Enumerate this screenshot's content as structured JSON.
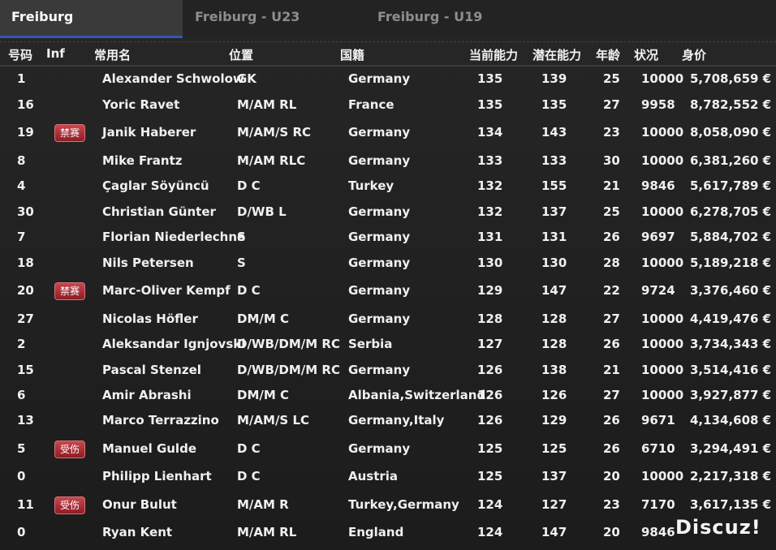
{
  "tabs": [
    "Freiburg",
    "Freiburg - U23",
    "Freiburg - U19"
  ],
  "columns": {
    "num": "号码",
    "inf": "Inf",
    "name": "常用名",
    "position": "位置",
    "nation": "国籍",
    "ca": "当前能力",
    "pa": "潜在能力",
    "age": "年龄",
    "condition": "状况",
    "value": "身价"
  },
  "players": [
    {
      "num": "1",
      "inf": "",
      "name": "Alexander Schwolow",
      "position": "GK",
      "nation": "Germany",
      "ca": "135",
      "pa": "139",
      "age": "25",
      "condition": "10000",
      "value": "5,708,659 €"
    },
    {
      "num": "16",
      "inf": "",
      "name": "Yoric Ravet",
      "position": "M/AM RL",
      "nation": "France",
      "ca": "135",
      "pa": "135",
      "age": "27",
      "condition": "9958",
      "value": "8,782,552 €"
    },
    {
      "num": "19",
      "inf": "禁赛",
      "name": "Janik Haberer",
      "position": "M/AM/S RC",
      "nation": "Germany",
      "ca": "134",
      "pa": "143",
      "age": "23",
      "condition": "10000",
      "value": "8,058,090 €"
    },
    {
      "num": "8",
      "inf": "",
      "name": "Mike Frantz",
      "position": "M/AM RLC",
      "nation": "Germany",
      "ca": "133",
      "pa": "133",
      "age": "30",
      "condition": "10000",
      "value": "6,381,260 €"
    },
    {
      "num": "4",
      "inf": "",
      "name": "Çaglar Söyüncü",
      "position": "D C",
      "nation": "Turkey",
      "ca": "132",
      "pa": "155",
      "age": "21",
      "condition": "9846",
      "value": "5,617,789 €"
    },
    {
      "num": "30",
      "inf": "",
      "name": "Christian Günter",
      "position": "D/WB L",
      "nation": "Germany",
      "ca": "132",
      "pa": "137",
      "age": "25",
      "condition": "10000",
      "value": "6,278,705 €"
    },
    {
      "num": "7",
      "inf": "",
      "name": "Florian Niederlechne",
      "position": "S",
      "nation": "Germany",
      "ca": "131",
      "pa": "131",
      "age": "26",
      "condition": "9697",
      "value": "5,884,702 €"
    },
    {
      "num": "18",
      "inf": "",
      "name": "Nils Petersen",
      "position": "S",
      "nation": "Germany",
      "ca": "130",
      "pa": "130",
      "age": "28",
      "condition": "10000",
      "value": "5,189,218 €"
    },
    {
      "num": "20",
      "inf": "禁赛",
      "name": "Marc-Oliver Kempf",
      "position": "D C",
      "nation": "Germany",
      "ca": "129",
      "pa": "147",
      "age": "22",
      "condition": "9724",
      "value": "3,376,460 €"
    },
    {
      "num": "27",
      "inf": "",
      "name": "Nicolas Höfler",
      "position": "DM/M C",
      "nation": "Germany",
      "ca": "128",
      "pa": "128",
      "age": "27",
      "condition": "10000",
      "value": "4,419,476 €"
    },
    {
      "num": "2",
      "inf": "",
      "name": "Aleksandar Ignjovski",
      "position": "D/WB/DM/M RC",
      "nation": "Serbia",
      "ca": "127",
      "pa": "128",
      "age": "26",
      "condition": "10000",
      "value": "3,734,343 €"
    },
    {
      "num": "15",
      "inf": "",
      "name": "Pascal Stenzel",
      "position": "D/WB/DM/M RC",
      "nation": "Germany",
      "ca": "126",
      "pa": "138",
      "age": "21",
      "condition": "10000",
      "value": "3,514,416 €"
    },
    {
      "num": "6",
      "inf": "",
      "name": "Amir Abrashi",
      "position": "DM/M C",
      "nation": "Albania,Switzerland",
      "ca": "126",
      "pa": "126",
      "age": "27",
      "condition": "10000",
      "value": "3,927,877 €"
    },
    {
      "num": "13",
      "inf": "",
      "name": "Marco Terrazzino",
      "position": "M/AM/S LC",
      "nation": "Germany,Italy",
      "ca": "126",
      "pa": "129",
      "age": "26",
      "condition": "9671",
      "value": "4,134,608 €"
    },
    {
      "num": "5",
      "inf": "受伤",
      "name": "Manuel Gulde",
      "position": "D C",
      "nation": "Germany",
      "ca": "125",
      "pa": "125",
      "age": "26",
      "condition": "6710",
      "value": "3,294,491 €"
    },
    {
      "num": "0",
      "inf": "",
      "name": "Philipp Lienhart",
      "position": "D C",
      "nation": "Austria",
      "ca": "125",
      "pa": "137",
      "age": "20",
      "condition": "10000",
      "value": "2,217,318 €"
    },
    {
      "num": "11",
      "inf": "受伤",
      "name": "Onur Bulut",
      "position": "M/AM R",
      "nation": "Turkey,Germany",
      "ca": "124",
      "pa": "127",
      "age": "23",
      "condition": "7170",
      "value": "3,617,135 €"
    },
    {
      "num": "0",
      "inf": "",
      "name": "Ryan Kent",
      "position": "M/AM RL",
      "nation": "England",
      "ca": "124",
      "pa": "147",
      "age": "20",
      "condition": "9846",
      "value": ""
    }
  ],
  "watermark": "Discuz!"
}
